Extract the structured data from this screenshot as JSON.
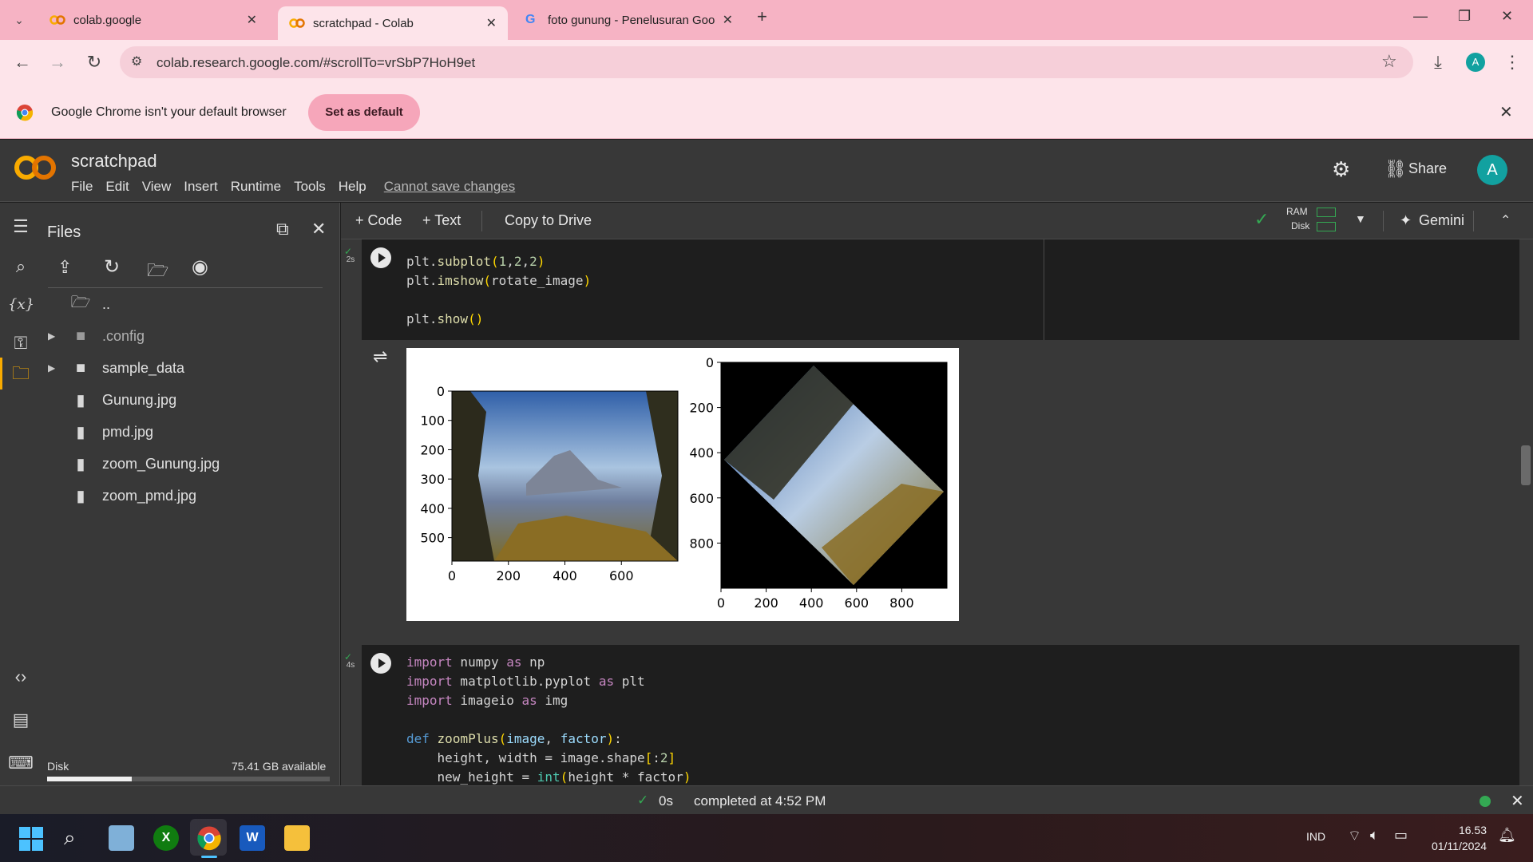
{
  "browser": {
    "tabs": [
      {
        "title": "colab.google",
        "active": false
      },
      {
        "title": "scratchpad - Colab",
        "active": true
      },
      {
        "title": "foto gunung - Penelusuran Goo",
        "active": false
      }
    ],
    "url": "colab.research.google.com/#scrollTo=vrSbP7HoH9et",
    "infobar_text": "Google Chrome isn't your default browser",
    "set_default_label": "Set as default",
    "profile_initial": "A"
  },
  "colab": {
    "notebook_title": "scratchpad",
    "menu": [
      "File",
      "Edit",
      "View",
      "Insert",
      "Runtime",
      "Tools",
      "Help"
    ],
    "save_warning": "Cannot save changes",
    "share_label": "Share",
    "avatar_initial": "A",
    "toolbar": {
      "code_label": "+ Code",
      "text_label": "+ Text",
      "copy_label": "Copy to Drive",
      "ram_label": "RAM",
      "disk_label": "Disk",
      "gemini_label": "Gemini"
    }
  },
  "files_panel": {
    "title": "Files",
    "items": [
      {
        "name": "..",
        "type": "folder-open"
      },
      {
        "name": ".config",
        "type": "folder"
      },
      {
        "name": "sample_data",
        "type": "folder"
      },
      {
        "name": "Gunung.jpg",
        "type": "file"
      },
      {
        "name": "pmd.jpg",
        "type": "file"
      },
      {
        "name": "zoom_Gunung.jpg",
        "type": "file"
      },
      {
        "name": "zoom_pmd.jpg",
        "type": "file"
      }
    ],
    "disk_label": "Disk",
    "disk_available": "75.41 GB available",
    "disk_used_fraction": 0.3
  },
  "cells": [
    {
      "exec_time": "2s",
      "lines": [
        "plt.subplot(1,2,2)",
        "plt.imshow(rotate_image)",
        "",
        "plt.show()"
      ]
    },
    {
      "exec_time": "4s",
      "lines": [
        "import numpy as np",
        "import matplotlib.pyplot as plt",
        "import imageio as img",
        "",
        "def zoomPlus(image, factor):",
        "    height, width = image.shape[:2]",
        "    new_height = int(height * factor)"
      ]
    }
  ],
  "chart_data": [
    {
      "type": "image",
      "xticks": [
        "0",
        "200",
        "400",
        "600"
      ],
      "yticks": [
        "0",
        "100",
        "200",
        "300",
        "400",
        "500"
      ],
      "xlim": [
        0,
        800
      ],
      "ylim": [
        580,
        0
      ]
    },
    {
      "type": "image",
      "xticks": [
        "0",
        "200",
        "400",
        "600",
        "800"
      ],
      "yticks": [
        "0",
        "200",
        "400",
        "600",
        "800"
      ],
      "xlim": [
        0,
        1000
      ],
      "ylim": [
        1000,
        0
      ]
    }
  ],
  "status": {
    "elapsed": "0s",
    "text": "completed at 4:52 PM"
  },
  "taskbar": {
    "lang": "IND",
    "time": "16.53",
    "date": "01/11/2024"
  }
}
